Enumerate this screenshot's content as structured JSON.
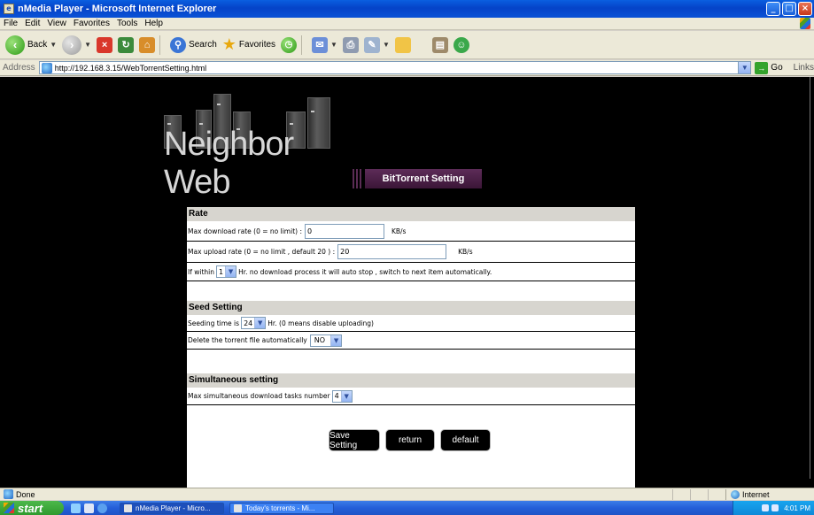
{
  "window": {
    "title": "nMedia Player - Microsoft Internet Explorer",
    "buttons": {
      "minimize": "_",
      "maximize": "□",
      "close": "×"
    }
  },
  "menu": [
    "File",
    "Edit",
    "View",
    "Favorites",
    "Tools",
    "Help"
  ],
  "toolbar": {
    "back": "Back",
    "search": "Search",
    "favorites": "Favorites"
  },
  "address": {
    "label": "Address",
    "url": "http://192.168.3.15/WebTorrentSetting.html",
    "go": "Go",
    "links": "Links"
  },
  "logo": {
    "text": "Neighbor Web"
  },
  "heading": "BitTorrent Setting",
  "sections": {
    "rate": {
      "title": "Rate",
      "max_download_label": "Max download rate (0 = no limit) :",
      "max_download_value": "0",
      "max_download_unit": "KB/s",
      "max_upload_label": "Max upload rate (0 = no limit , default 20 ) :",
      "max_upload_value": "20",
      "max_upload_unit": "KB/s",
      "auto_stop_prefix": "If within",
      "auto_stop_value": "1",
      "auto_stop_suffix": "Hr. no download process it will auto stop , switch to next item automatically."
    },
    "seed": {
      "title": "Seed Setting",
      "seeding_prefix": "Seeding time is",
      "seeding_value": "24",
      "seeding_suffix": "Hr. (0 means disable uploading)",
      "delete_label": "Delete the torrent file automatically",
      "delete_value": "NO"
    },
    "simultaneous": {
      "title": "Simultaneous setting",
      "max_tasks_label": "Max simultaneous download tasks number",
      "max_tasks_value": "4"
    }
  },
  "buttons": {
    "save": "Save Setting",
    "return": "return",
    "default": "default"
  },
  "status": {
    "text": "Done",
    "zone": "Internet"
  },
  "taskbar": {
    "start": "start",
    "tasks": [
      "nMedia Player - Micro...",
      "Today's torrents - Mi..."
    ],
    "clock": "4:01 PM"
  }
}
